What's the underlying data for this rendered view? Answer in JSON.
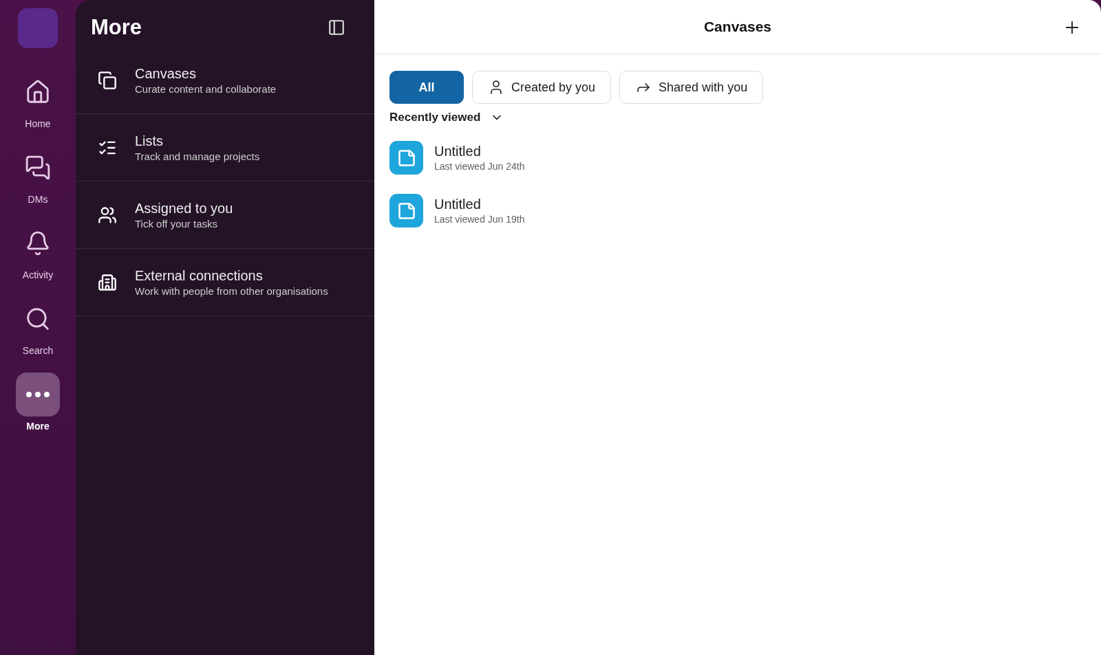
{
  "rail": {
    "items": [
      {
        "label": "Home",
        "selected": false
      },
      {
        "label": "DMs",
        "selected": false
      },
      {
        "label": "Activity",
        "selected": false
      },
      {
        "label": "Search",
        "selected": false
      },
      {
        "label": "More",
        "selected": true
      }
    ]
  },
  "panel": {
    "title": "More",
    "items": [
      {
        "title": "Canvases",
        "subtitle": "Curate content and collaborate"
      },
      {
        "title": "Lists",
        "subtitle": "Track and manage projects"
      },
      {
        "title": "Assigned to you",
        "subtitle": "Tick off your tasks"
      },
      {
        "title": "External connections",
        "subtitle": "Work with people from other organisations"
      }
    ]
  },
  "main": {
    "title": "Canvases",
    "filters": [
      {
        "label": "All",
        "selected": true
      },
      {
        "label": "Created by you",
        "selected": false
      },
      {
        "label": "Shared with you",
        "selected": false
      }
    ],
    "sort": "Recently viewed",
    "canvases": [
      {
        "title": "Untitled",
        "subtitle": "Last viewed Jun 24th"
      },
      {
        "title": "Untitled",
        "subtitle": "Last viewed Jun 19th"
      }
    ]
  }
}
